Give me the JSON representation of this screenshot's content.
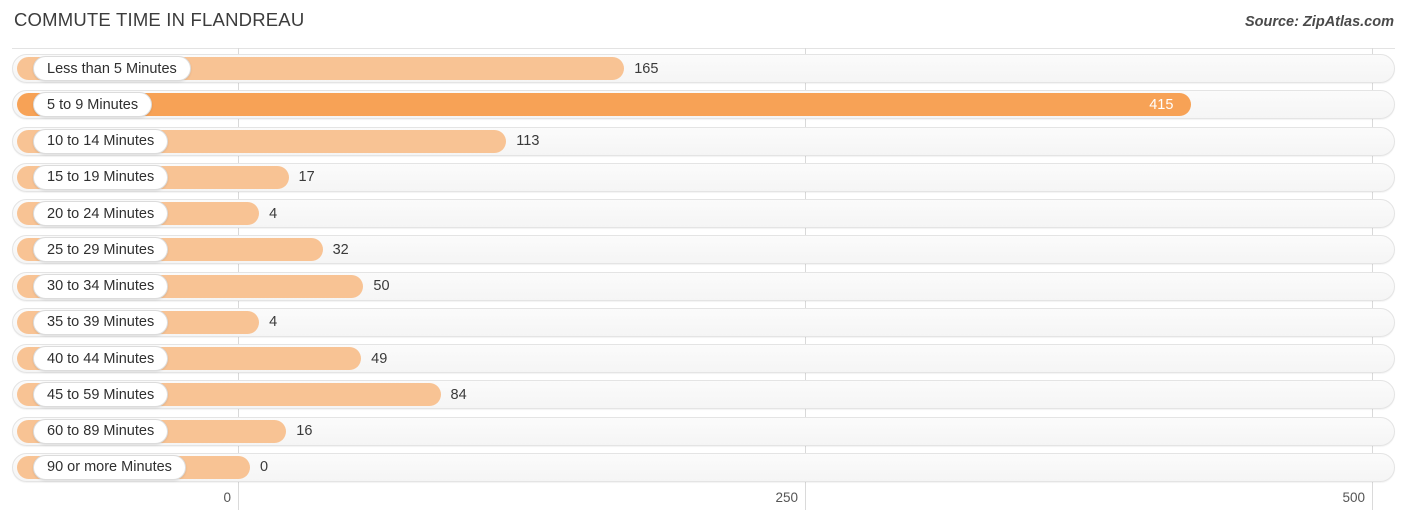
{
  "header": {
    "title": "COMMUTE TIME IN FLANDREAU",
    "source": "Source: ZipAtlas.com"
  },
  "chart_data": {
    "type": "bar",
    "orientation": "horizontal",
    "title": "COMMUTE TIME IN FLANDREAU",
    "xlabel": "",
    "ylabel": "",
    "xlim": [
      0,
      500
    ],
    "xticks": [
      0,
      250,
      500
    ],
    "xtick_labels": [
      "0",
      "250",
      "500"
    ],
    "grid": true,
    "legend": null,
    "highlight_index": 1,
    "colors": {
      "bar": "#f8c394",
      "bar_highlight": "#f7a256",
      "track": "#f7f7f7",
      "gridline": "#d9d9d9",
      "value_text": "#3a3a3a",
      "value_text_inside": "#ffffff"
    },
    "categories": [
      "Less than 5 Minutes",
      "5 to 9 Minutes",
      "10 to 14 Minutes",
      "15 to 19 Minutes",
      "20 to 24 Minutes",
      "25 to 29 Minutes",
      "30 to 34 Minutes",
      "35 to 39 Minutes",
      "40 to 44 Minutes",
      "45 to 59 Minutes",
      "60 to 89 Minutes",
      "90 or more Minutes"
    ],
    "values": [
      165,
      415,
      113,
      17,
      4,
      32,
      50,
      4,
      49,
      84,
      16,
      0
    ],
    "value_labels": [
      "165",
      "415",
      "113",
      "17",
      "4",
      "32",
      "50",
      "4",
      "49",
      "84",
      "16",
      "0"
    ]
  }
}
